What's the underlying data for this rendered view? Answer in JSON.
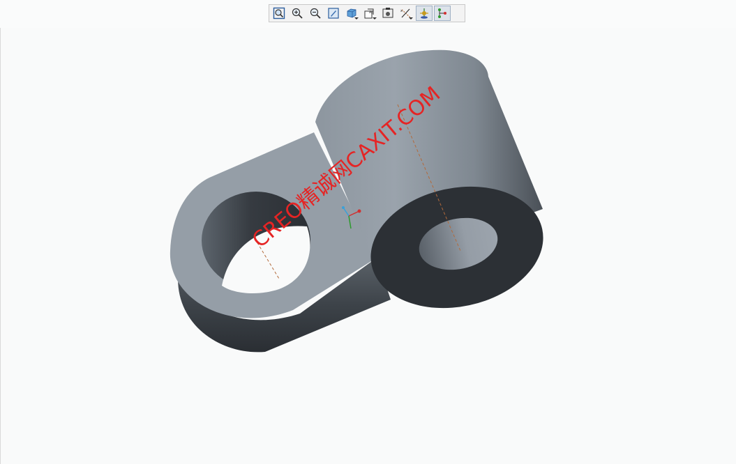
{
  "toolbar": {
    "buttons": [
      {
        "name": "refit",
        "icon": "zoom-fit-icon"
      },
      {
        "name": "zoom-in",
        "icon": "zoom-in-icon"
      },
      {
        "name": "zoom-out",
        "icon": "zoom-out-icon"
      },
      {
        "name": "repaint",
        "icon": "repaint-icon"
      },
      {
        "name": "display-style",
        "icon": "shaded-cube-icon",
        "dropdown": true
      },
      {
        "name": "saved-views",
        "icon": "saved-views-icon",
        "dropdown": true
      },
      {
        "name": "view-manager",
        "icon": "view-manager-icon"
      },
      {
        "name": "datum-display",
        "icon": "datum-display-icon",
        "dropdown": true
      },
      {
        "name": "spin-center",
        "icon": "spin-center-icon",
        "active": true
      },
      {
        "name": "annotation-display",
        "icon": "annotation-display-icon",
        "active": true
      }
    ]
  },
  "watermark": {
    "text": "CREO精诚网CAXIT.COM",
    "color": "#e52424"
  },
  "colors": {
    "part_face": "#959ea7",
    "part_dark": "#2c3035",
    "axis_line": "#b36a3a",
    "background": "#f9fafa"
  }
}
